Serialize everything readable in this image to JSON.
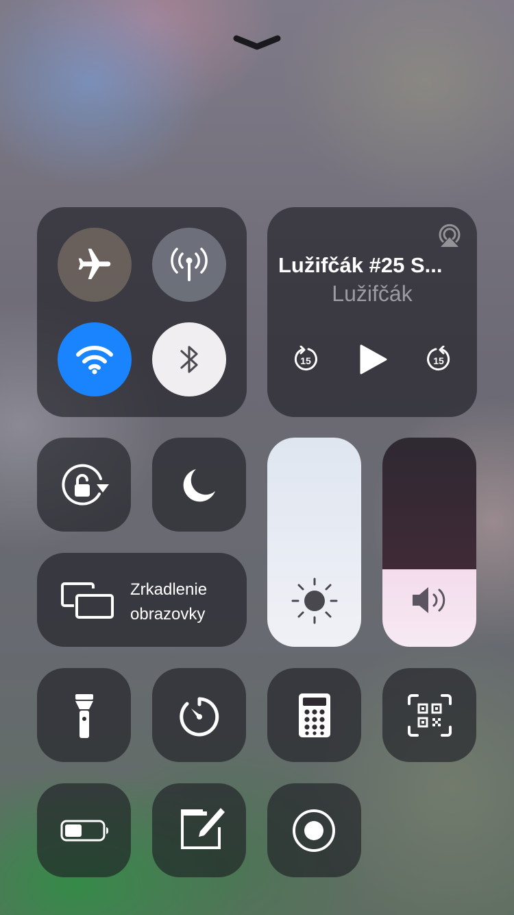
{
  "control_center": {
    "dismiss_icon": "chevron-down-icon",
    "connectivity": {
      "airplane_mode": {
        "icon": "airplane-icon",
        "on": false
      },
      "cellular_data": {
        "icon": "antenna-icon",
        "on": false
      },
      "wifi": {
        "icon": "wifi-icon",
        "on": true,
        "color": "#1a84ff"
      },
      "bluetooth": {
        "icon": "bluetooth-icon",
        "on": false
      }
    },
    "now_playing": {
      "title": "Lužifčák #25 S...",
      "artist": "Lužifčák",
      "skip_back_seconds": "15",
      "skip_forward_seconds": "15",
      "airplay_icon": "airplay-icon"
    },
    "orientation_lock": {
      "icon": "rotation-lock-icon"
    },
    "do_not_disturb": {
      "icon": "moon-icon"
    },
    "screen_mirroring": {
      "line1": "Zrkadlenie",
      "line2": "obrazovky",
      "icon": "screen-mirroring-icon"
    },
    "brightness": {
      "level": 1.0,
      "icon": "sun-icon"
    },
    "volume": {
      "level": 0.37,
      "icon": "speaker-icon"
    },
    "shortcuts": [
      {
        "name": "flashlight",
        "icon": "flashlight-icon"
      },
      {
        "name": "timer",
        "icon": "timer-icon"
      },
      {
        "name": "calculator",
        "icon": "calculator-icon"
      },
      {
        "name": "qr-scanner",
        "icon": "qr-code-icon"
      },
      {
        "name": "low-power-mode",
        "icon": "battery-icon"
      },
      {
        "name": "notes",
        "icon": "notes-icon"
      },
      {
        "name": "screen-recording",
        "icon": "record-icon"
      }
    ]
  }
}
